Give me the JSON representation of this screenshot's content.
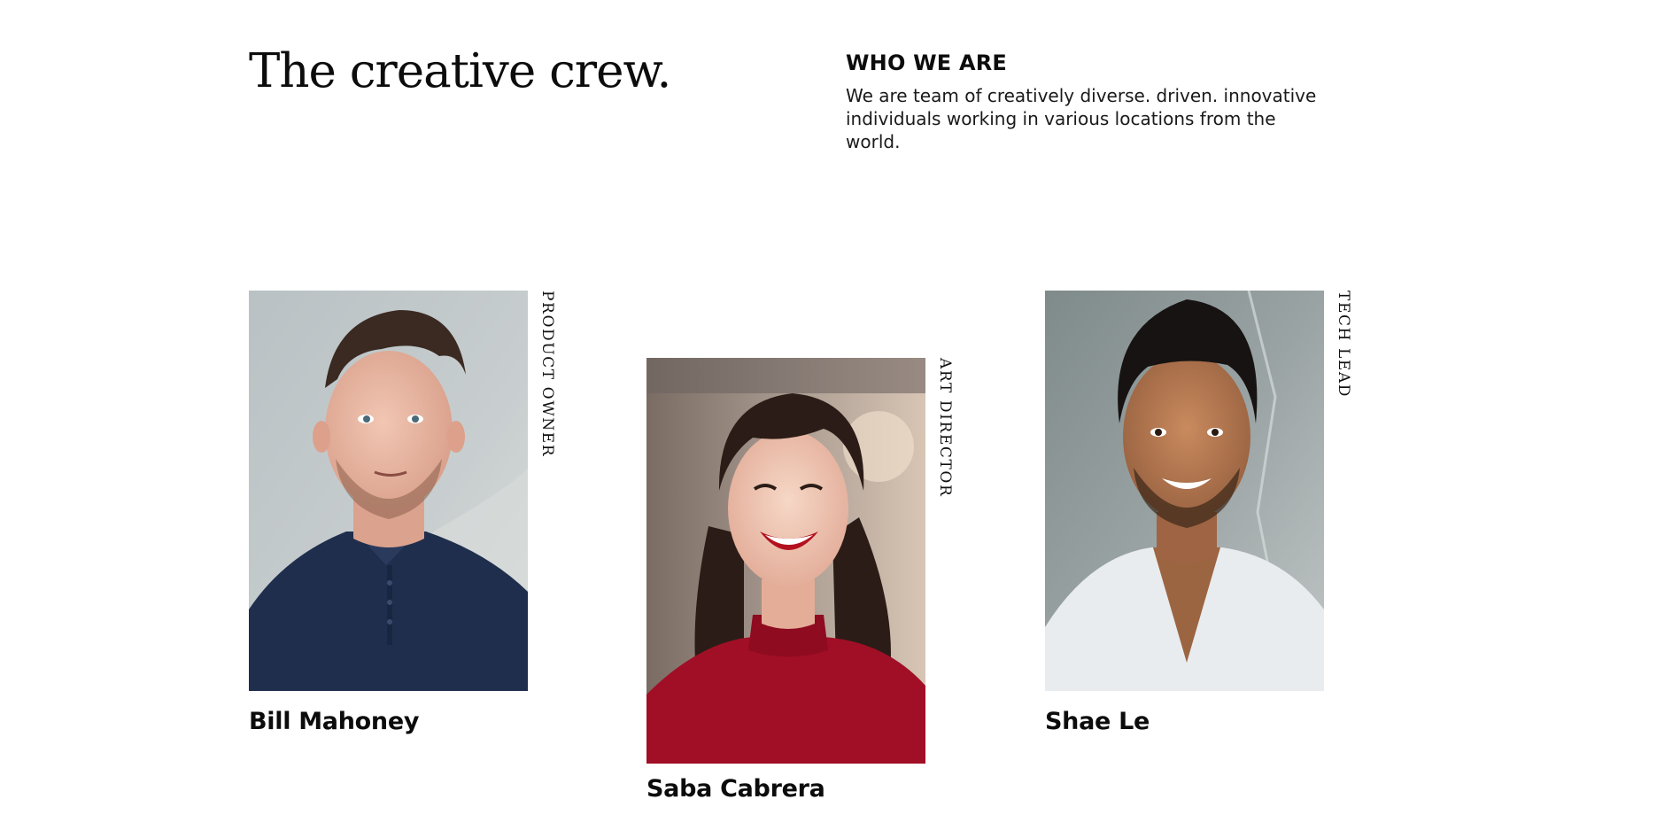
{
  "header": {
    "headline": "The creative crew.",
    "who_title": "WHO WE ARE",
    "who_text": "We are team of creatively diverse. driven. innovative individuals working in various locations from the world."
  },
  "team": [
    {
      "name": "Bill Mahoney",
      "role": "PRODUCT OWNER",
      "photo_icon": "portrait-photo"
    },
    {
      "name": "Saba Cabrera",
      "role": "ART DIRECTOR",
      "photo_icon": "portrait-photo"
    },
    {
      "name": "Shae Le",
      "role": "TECH LEAD",
      "photo_icon": "portrait-photo"
    }
  ]
}
